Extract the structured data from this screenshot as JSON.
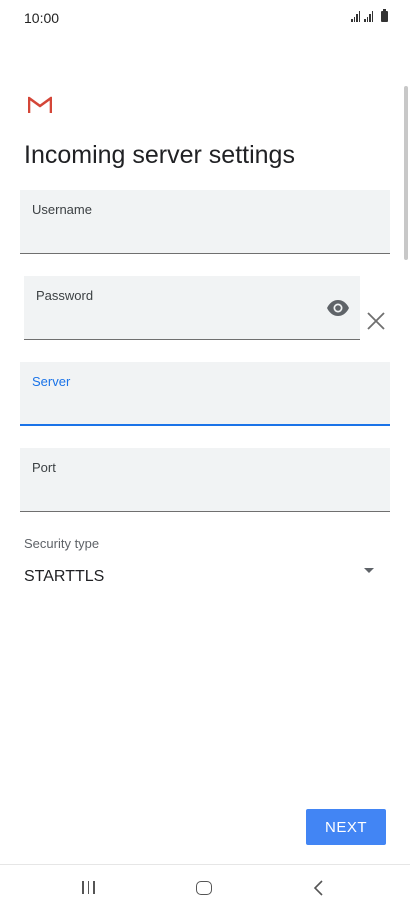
{
  "status_bar": {
    "time": "10:00",
    "icons": [
      "signal-icon",
      "signal-icon",
      "battery-icon"
    ]
  },
  "app": {
    "logo": "gmail-logo",
    "brand_color": "#d44638"
  },
  "page": {
    "title": "Incoming server settings"
  },
  "form": {
    "username": {
      "label": "Username",
      "value": ""
    },
    "password": {
      "label": "Password",
      "value": "",
      "visibility_icon": "eye-icon",
      "clear_icon": "close-icon"
    },
    "server": {
      "label": "Server",
      "value": "",
      "focused": true
    },
    "port": {
      "label": "Port",
      "value": ""
    },
    "security": {
      "label": "Security type",
      "value": "STARTTLS",
      "icon": "dropdown-arrow-icon"
    }
  },
  "actions": {
    "next_label": "NEXT"
  },
  "nav_bar": {
    "icons": [
      "recents-icon",
      "home-icon",
      "back-icon"
    ]
  },
  "colors": {
    "accent": "#1a73e8",
    "button": "#4285f4",
    "field_bg": "#f1f3f4"
  }
}
